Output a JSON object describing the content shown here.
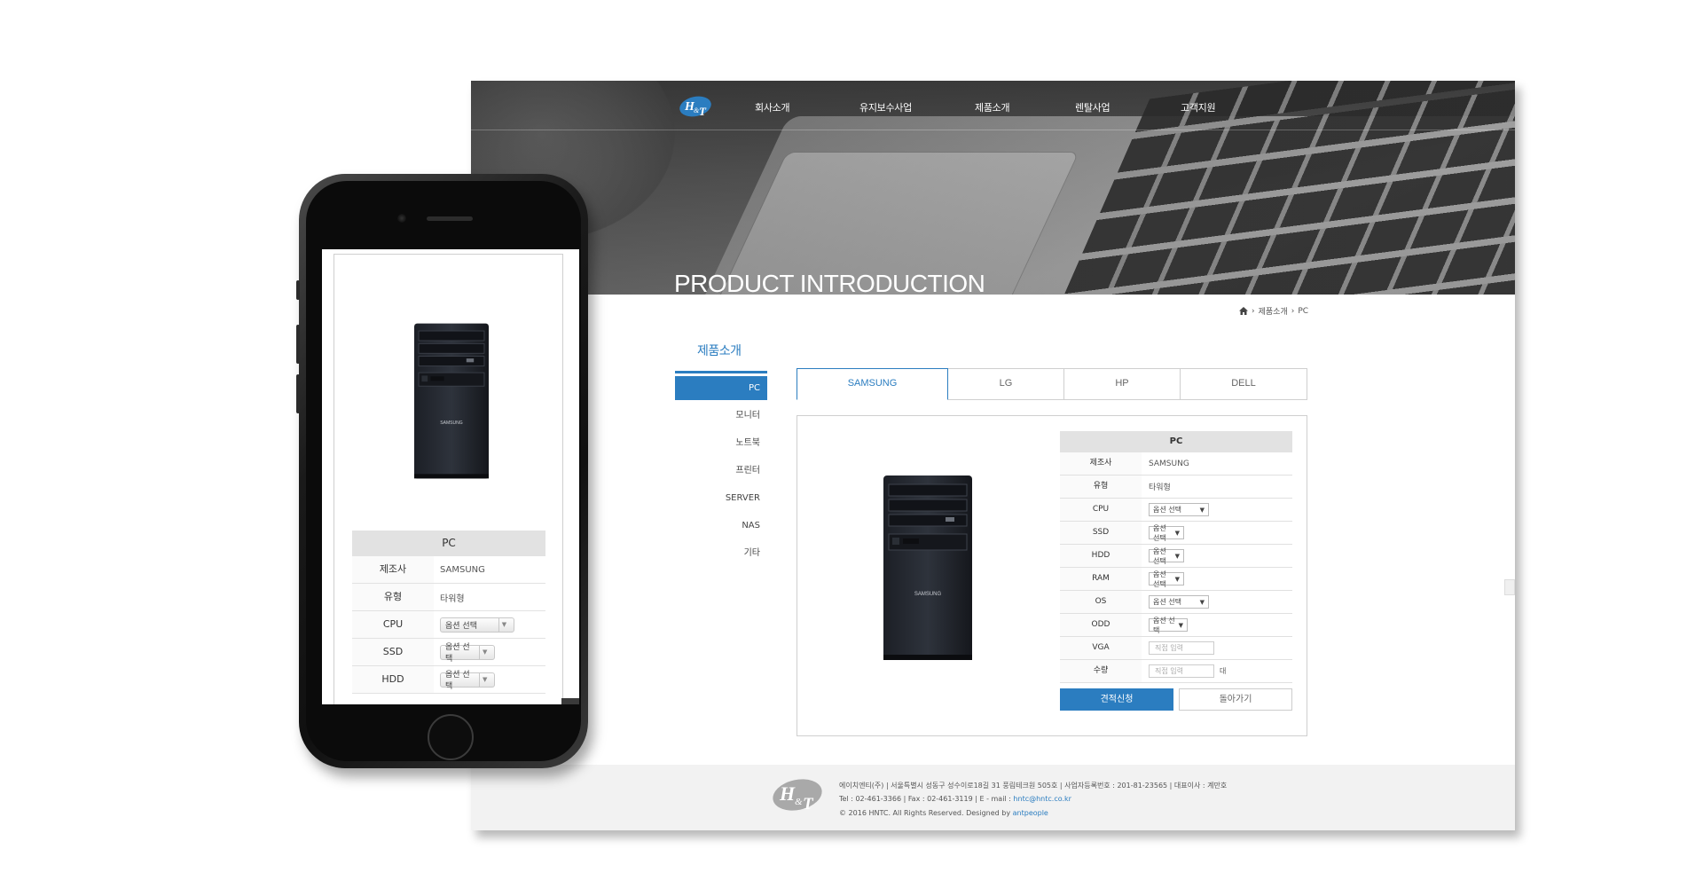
{
  "nav": {
    "items": [
      "회사소개",
      "유지보수사업",
      "제품소개",
      "렌탈사업",
      "고객지원"
    ]
  },
  "hero": {
    "title": "PRODUCT INTRODUCTION"
  },
  "breadcrumb": {
    "items": [
      "제품소개",
      "PC"
    ]
  },
  "sidebar": {
    "title": "제품소개",
    "items": [
      "PC",
      "모니터",
      "노트북",
      "프린터",
      "SERVER",
      "NAS",
      "기타"
    ],
    "active": "PC"
  },
  "tabs": {
    "items": [
      "SAMSUNG",
      "LG",
      "HP",
      "DELL"
    ],
    "active": "SAMSUNG"
  },
  "product": {
    "brand_on_image": "SAMSUNG",
    "spec_title": "PC",
    "rows": [
      {
        "label": "제조사",
        "value": "SAMSUNG"
      },
      {
        "label": "유형",
        "value": "타워형"
      },
      {
        "label": "CPU",
        "select": "옵션 선택"
      },
      {
        "label": "SSD",
        "select": "옵션 선택"
      },
      {
        "label": "HDD",
        "select": "옵션 선택"
      },
      {
        "label": "RAM",
        "select": "옵션 선택"
      },
      {
        "label": "OS",
        "select": "옵션 선택"
      },
      {
        "label": "ODD",
        "select": "옵션 선택"
      },
      {
        "label": "VGA",
        "placeholder": "직접 입력"
      },
      {
        "label": "수량",
        "placeholder": "직접 입력",
        "unit": "대"
      }
    ],
    "quote_button": "견적신청",
    "back_button": "돌아가기"
  },
  "footer": {
    "line1": "에이치엔티(주) | 서울특별시 성동구 성수이로18길 31 풍림테크원 505호 | 사업자등록번호 : 201-81-23565 | 대표이사 : 계만호",
    "line2_prefix": "Tel : 02-461-3366 | Fax : 02-461-3119 | E - mail : ",
    "email": "hntc@hntc.co.kr",
    "line3_prefix": "© 2016 HNTC. All Rights Reserved. Designed by ",
    "designer": "antpeople"
  },
  "phone": {
    "spec_title": "PC",
    "rows": [
      {
        "label": "제조사",
        "value": "SAMSUNG"
      },
      {
        "label": "유형",
        "value": "타워형"
      },
      {
        "label": "CPU",
        "select": "옵션 선택"
      },
      {
        "label": "SSD",
        "select": "옵션 선택"
      },
      {
        "label": "HDD",
        "select": "옵션 선택"
      }
    ]
  },
  "colors": {
    "accent": "#2b7dc0",
    "footer_bg": "#f2f2f2",
    "table_head_bg": "#e2e2e2"
  },
  "icons": [
    "home-icon",
    "chevron-right-icon",
    "dropdown-arrow-icon",
    "logo-hnt"
  ]
}
